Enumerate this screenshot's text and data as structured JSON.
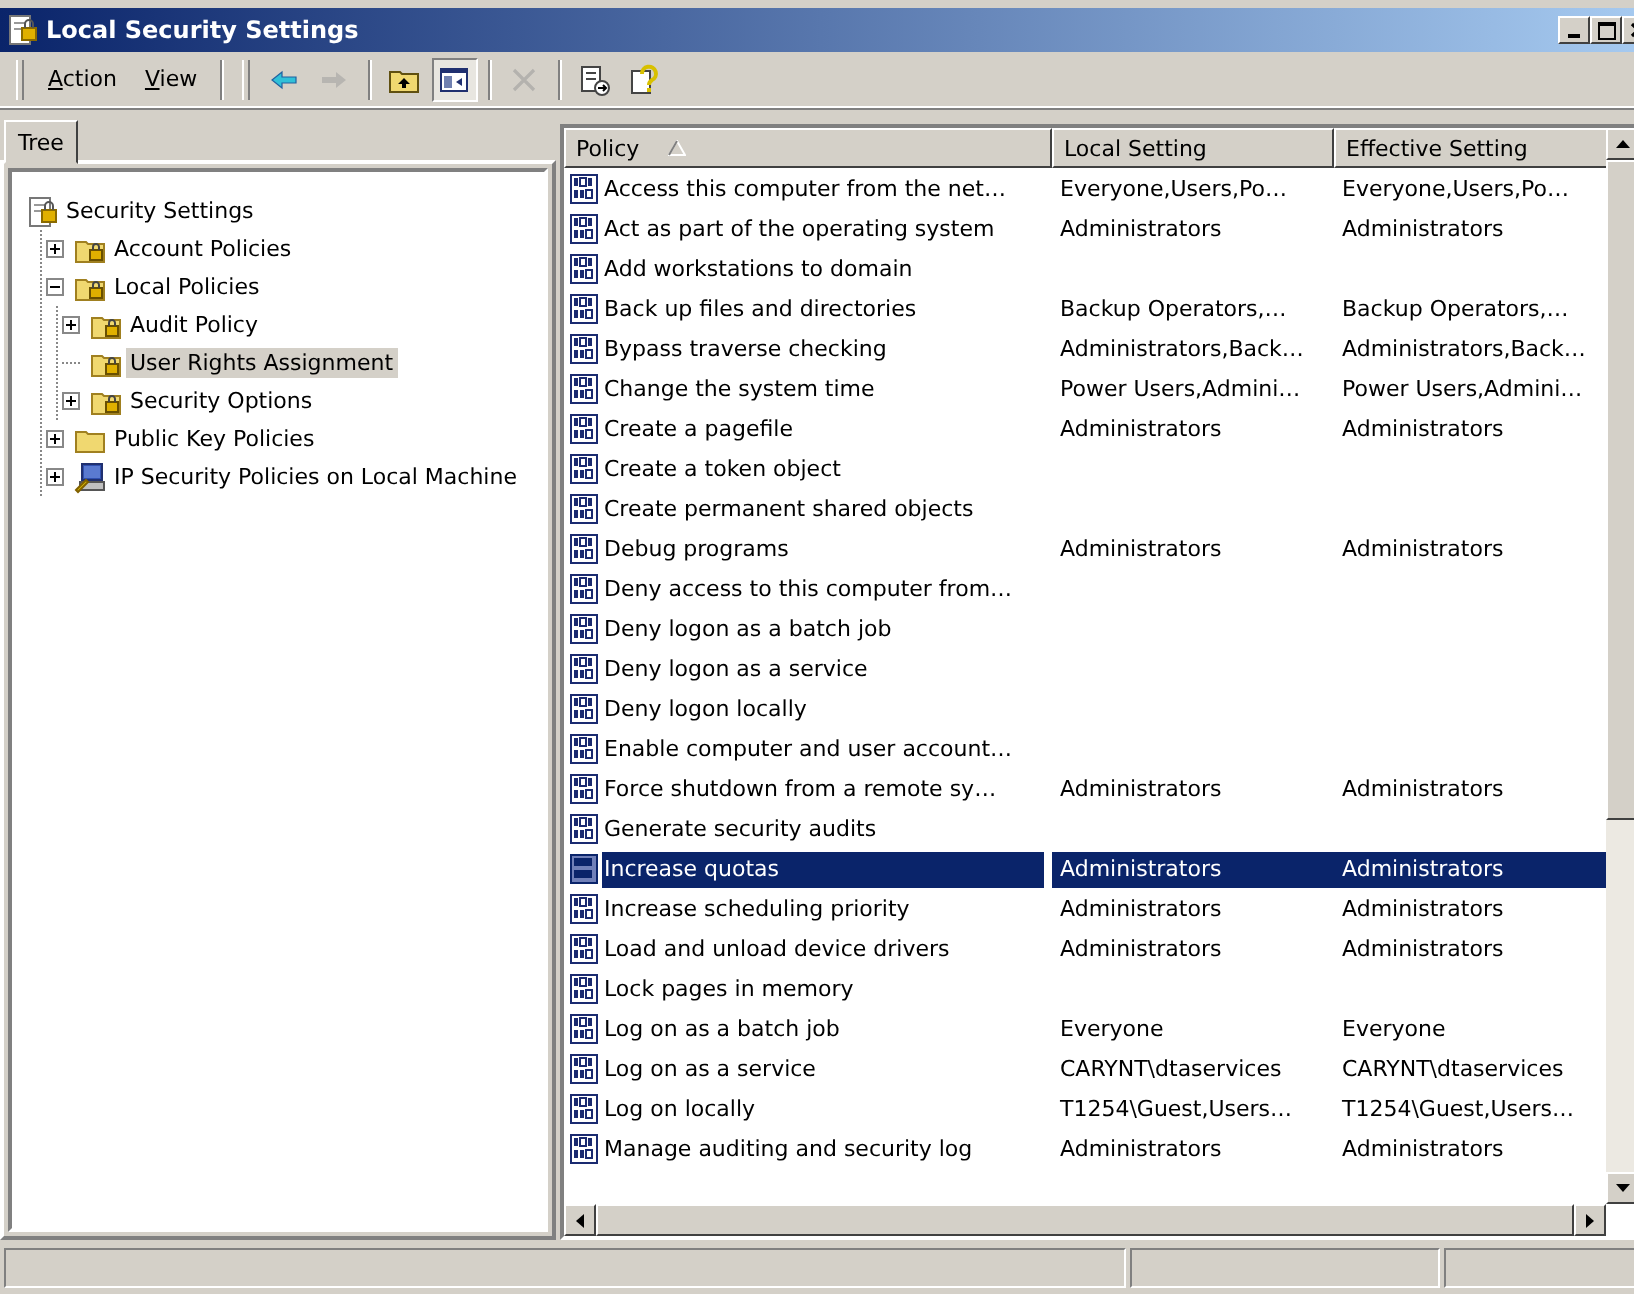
{
  "window": {
    "title": "Local Security Settings"
  },
  "menu": [
    {
      "label": "Action"
    },
    {
      "label": "View"
    }
  ],
  "toolbar": [
    {
      "kind": "back",
      "disabled": false,
      "pressed": false
    },
    {
      "kind": "forward",
      "disabled": true,
      "pressed": false
    },
    {
      "kind": "up",
      "disabled": false,
      "pressed": false
    },
    {
      "kind": "tree-toggle",
      "disabled": false,
      "pressed": true
    },
    {
      "kind": "delete",
      "disabled": true,
      "pressed": false
    },
    {
      "kind": "export",
      "disabled": false,
      "pressed": false
    },
    {
      "kind": "help",
      "disabled": false,
      "pressed": false
    }
  ],
  "tabs": [
    {
      "label": "Tree",
      "selected": true
    }
  ],
  "tree": [
    {
      "label": "Security Settings",
      "kind": "settings",
      "expandable": false,
      "selected": false,
      "children": [
        {
          "label": "Account Policies",
          "kind": "folder-lock",
          "expandable": true,
          "expanded": false,
          "selected": false
        },
        {
          "label": "Local Policies",
          "kind": "folder-lock",
          "expandable": true,
          "expanded": true,
          "selected": false,
          "children": [
            {
              "label": "Audit Policy",
              "kind": "folder-lock",
              "expandable": true,
              "expanded": false,
              "selected": false
            },
            {
              "label": "User Rights Assignment",
              "kind": "folder-lock",
              "expandable": false,
              "selected": true
            },
            {
              "label": "Security Options",
              "kind": "folder-lock",
              "expandable": true,
              "expanded": false,
              "selected": false
            }
          ]
        },
        {
          "label": "Public Key Policies",
          "kind": "folder",
          "expandable": true,
          "expanded": false,
          "selected": false
        },
        {
          "label": "IP Security Policies on Local Machine",
          "kind": "computer",
          "expandable": true,
          "expanded": false,
          "selected": false
        }
      ]
    }
  ],
  "table": {
    "columns": [
      {
        "label": "Policy",
        "sorted": true
      },
      {
        "label": "Local Setting",
        "sorted": false
      },
      {
        "label": "Effective Setting",
        "sorted": false
      }
    ],
    "rows": [
      {
        "policy": "Access this computer from the net…",
        "local": "Everyone,Users,Po…",
        "effective": "Everyone,Users,Po…",
        "selected": false
      },
      {
        "policy": "Act as part of the operating system",
        "local": "Administrators",
        "effective": "Administrators",
        "selected": false
      },
      {
        "policy": "Add workstations to domain",
        "selected": false
      },
      {
        "policy": "Back up files and directories",
        "local": "Backup Operators,…",
        "effective": "Backup Operators,…",
        "selected": false
      },
      {
        "policy": "Bypass traverse checking",
        "local": "Administrators,Back…",
        "effective": "Administrators,Back…",
        "selected": false
      },
      {
        "policy": "Change the system time",
        "local": "Power Users,Admini…",
        "effective": "Power Users,Admini…",
        "selected": false
      },
      {
        "policy": "Create a pagefile",
        "local": "Administrators",
        "effective": "Administrators",
        "selected": false
      },
      {
        "policy": "Create a token object",
        "selected": false
      },
      {
        "policy": "Create permanent shared objects",
        "selected": false
      },
      {
        "policy": "Debug programs",
        "local": "Administrators",
        "effective": "Administrators",
        "selected": false
      },
      {
        "policy": "Deny access to this computer from…",
        "selected": false
      },
      {
        "policy": "Deny logon as a batch job",
        "selected": false
      },
      {
        "policy": "Deny logon as a service",
        "selected": false
      },
      {
        "policy": "Deny logon locally",
        "selected": false
      },
      {
        "policy": "Enable computer and user account…",
        "selected": false
      },
      {
        "policy": "Force shutdown from a remote sy…",
        "local": "Administrators",
        "effective": "Administrators",
        "selected": false
      },
      {
        "policy": "Generate security audits",
        "selected": false
      },
      {
        "policy": "Increase quotas",
        "local": "Administrators",
        "effective": "Administrators",
        "selected": true
      },
      {
        "policy": "Increase scheduling priority",
        "local": "Administrators",
        "effective": "Administrators",
        "selected": false
      },
      {
        "policy": "Load and unload device drivers",
        "local": "Administrators",
        "effective": "Administrators",
        "selected": false
      },
      {
        "policy": "Lock pages in memory",
        "selected": false
      },
      {
        "policy": "Log on as a batch job",
        "local": "Everyone",
        "effective": "Everyone",
        "selected": false
      },
      {
        "policy": "Log on as a service",
        "local": "CARYNT\\dtaservices",
        "effective": "CARYNT\\dtaservices",
        "selected": false
      },
      {
        "policy": "Log on locally",
        "local": "T1254\\Guest,Users…",
        "effective": "T1254\\Guest,Users…",
        "selected": false
      },
      {
        "policy": "Manage auditing and security log",
        "local": "Administrators",
        "effective": "Administrators",
        "selected": false
      }
    ]
  }
}
